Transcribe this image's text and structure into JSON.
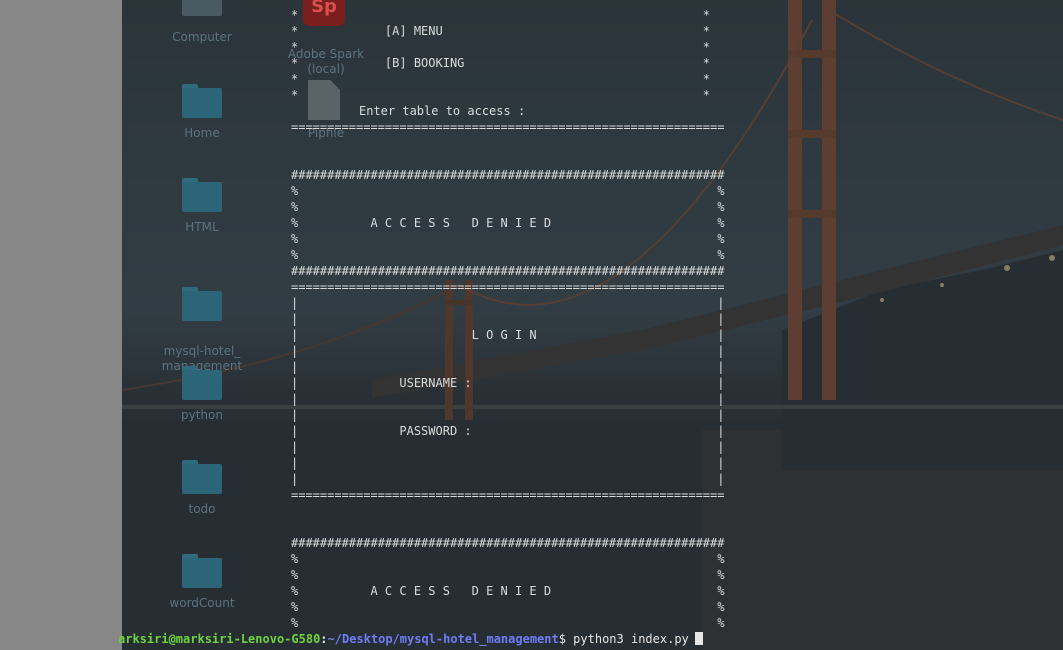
{
  "desktop": {
    "icons": [
      {
        "label": "Computer",
        "type": "computer-icon"
      },
      {
        "label": "Home",
        "type": "folder-icon"
      },
      {
        "label": "HTML",
        "type": "folder-icon"
      },
      {
        "label": "mysql-hotel_\nmanagement",
        "type": "folder-icon"
      },
      {
        "label": "python",
        "type": "folder-icon"
      },
      {
        "label": "todo",
        "type": "folder-icon"
      },
      {
        "label": "wordCount",
        "type": "folder-icon"
      }
    ],
    "second_column": [
      {
        "label": "Adobe Spark\n(local)",
        "type": "adobe-spark-icon",
        "logo_text": "Sp"
      },
      {
        "label": "Pipfile",
        "type": "document-icon"
      }
    ]
  },
  "terminal": {
    "menu_block": "*                                                        *\n*            [A] MENU                                    *\n*                                                        *\n*            [B] BOOKING                                 *\n*                                                        *\n*                                                        *",
    "enter_table": "Enter table to access :",
    "separator_eq": "============================================================",
    "separator_hash": "############################################################",
    "access_denied_block_1": "%                                                          %\n%                                                          %\n%          A C C E S S   D E N I E D                       %\n%                                                          %\n%                                                          %",
    "login_block": "|                                                          |\n|                                                          |\n|                        L O G I N                         |\n|                                                          |\n|                                                          |\n|              USERNAME :                                  |\n|                                                          |\n|                                                          |\n|              PASSWORD :                                  |\n|                                                          |\n|                                                          |\n|                                                          |",
    "access_denied_block_2": "%                                                          %\n%                                                          %\n%          A C C E S S   D E N I E D                       %\n%                                                          %\n%                                                          %",
    "prompt": {
      "user_host": "arksiri@marksiri-Lenovo-G580",
      "colon": ":",
      "path": "~/Desktop/mysql-hotel_management",
      "dollar": "$",
      "command": " python3 index.py"
    }
  },
  "colors": {
    "prompt_user": "#6fd33d",
    "prompt_path": "#6e7df6",
    "terminal_text": "#d9dcdc"
  }
}
